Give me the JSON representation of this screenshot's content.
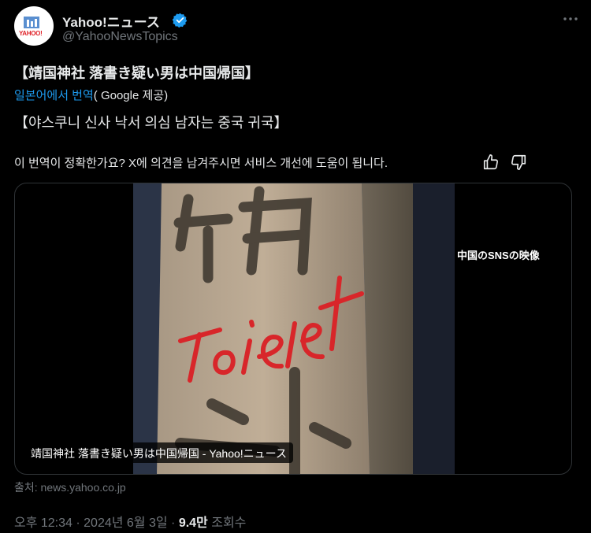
{
  "author": {
    "name": "Yahoo!ニュース",
    "handle": "@YahooNewsTopics",
    "avatar_logo": "YAHOO!"
  },
  "tweet": {
    "title": "【靖国神社 落書き疑い男は中国帰国】",
    "translated_from_link": "일본어에서 번역",
    "translated_from_rest": "( Google 제공)",
    "translated_title": "【야스쿠니 신사 낙서 의심 남자는 중국 귀국】",
    "feedback_prompt": "이 번역이 정확한가요? X에 의견을 남겨주시면 서비스 개선에 도움이 됩니다."
  },
  "media": {
    "overlay_caption": "中国のSNSの映像",
    "card_caption": "靖国神社 落書き疑い男は中国帰国 - Yahoo!ニュース"
  },
  "source": "출처: news.yahoo.co.jp",
  "meta": {
    "time_date": "오후 12:34 · 2024년 6월 3일 · ",
    "views_count": "9.4만",
    "views_label": " 조회수"
  },
  "colors": {
    "accent": "#1d9bf0",
    "muted": "#71767b",
    "text": "#e7e9ea",
    "background": "#000000",
    "graffiti": "#d8262a"
  },
  "icons": [
    "verified-badge-icon",
    "more-options-icon",
    "thumbs-up-icon",
    "thumbs-down-icon"
  ]
}
